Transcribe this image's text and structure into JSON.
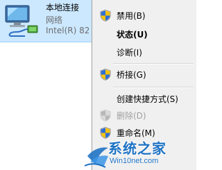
{
  "adapter": {
    "name": "本地连接",
    "status": "网络",
    "device": "Intel(R) 82"
  },
  "context_menu": {
    "items": [
      {
        "label": "禁用(B)",
        "icon": "uac-shield-icon",
        "bold": false,
        "disabled": false
      },
      {
        "label": "状态(U)",
        "icon": "",
        "bold": true,
        "disabled": false
      },
      {
        "label": "诊断(I)",
        "icon": "",
        "bold": false,
        "disabled": false
      },
      {
        "label": "桥接(G)",
        "icon": "uac-shield-icon",
        "bold": false,
        "disabled": false
      },
      {
        "label": "创建快捷方式(S)",
        "icon": "",
        "bold": false,
        "disabled": false
      },
      {
        "label": "删除(D)",
        "icon": "uac-shield-icon",
        "bold": false,
        "disabled": true
      },
      {
        "label": "重命名(M)",
        "icon": "uac-shield-icon",
        "bold": false,
        "disabled": false
      }
    ]
  },
  "watermark": {
    "title": "系统之家",
    "url": "Win10net.com"
  },
  "colors": {
    "selection": "#cce8ff",
    "menu_bg": "#f0f0f0",
    "watermark_blue": "#1f73c4"
  }
}
